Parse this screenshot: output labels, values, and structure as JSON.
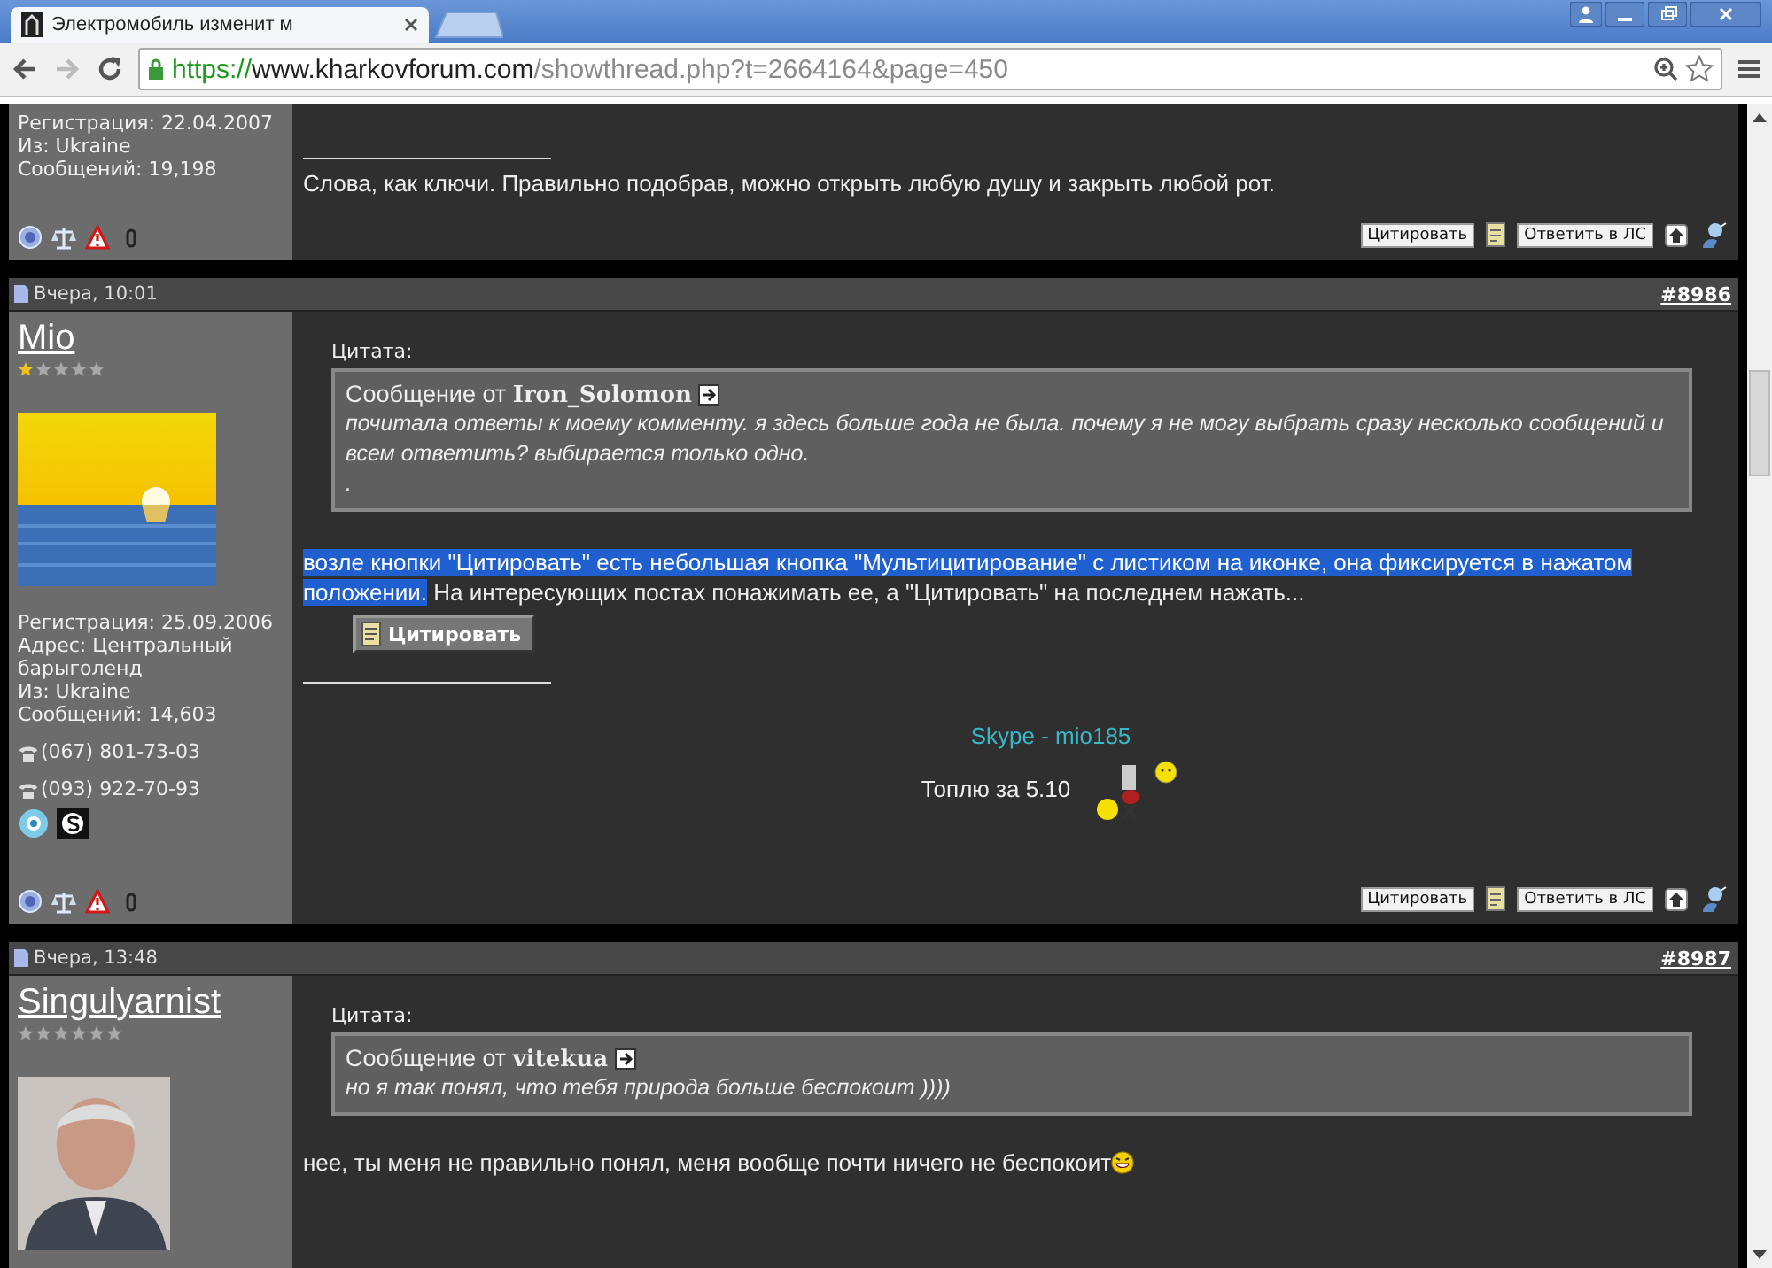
{
  "browser": {
    "tab_title": "Электромобиль изменит м",
    "url": {
      "scheme": "https://",
      "host": "www.kharkovforum.com",
      "path": "/showthread.php?t=2664164&page=450"
    }
  },
  "posts": [
    {
      "kind": "partial",
      "user": {
        "stats": [
          "Регистрация: 22.04.2007",
          "Из: Ukraine",
          "Сообщений: 19,198"
        ]
      },
      "signature": [
        {
          "kind": "plain",
          "text": "Слова, как ключи. Правильно подобрав, можно открыть любую душу и закрыть любой рот."
        }
      ],
      "actions": {
        "quote": "Цитировать",
        "reply_pm": "Ответить в ЛС"
      }
    },
    {
      "kind": "full",
      "date": "Вчера, 10:01",
      "number": "#8986",
      "user": {
        "name": "Mio",
        "rank": [
          {
            "filled": true
          },
          {
            "filled": false
          },
          {
            "filled": false
          },
          {
            "filled": false
          },
          {
            "filled": false
          }
        ],
        "avatar": {
          "kind": "picture"
        },
        "stats": [
          "Регистрация: 25.09.2006",
          "Адрес: Центральный барыголенд",
          "Из: Ukraine",
          "Сообщений: 14,603"
        ],
        "phones": [
          "(067) 801-73-03",
          "(093) 922-70-93"
        ],
        "contacts": true
      },
      "quote": {
        "label": "Цитата:",
        "from": "Сообщение от",
        "author": "Iron_Solomon",
        "lines": [
          "почитала ответы к моему комменту. я здесь больше года не была. почему я не могу выбрать сразу несколько сообщений и всем ответить? выбирается только одно.",
          "."
        ]
      },
      "message": [
        {
          "text": "возле кнопки \"Цитировать\" есть небольшая кнопка \"Мультицитирование\" с листиком на иконке, она фиксируется в нажатом положении.",
          "selected": true
        },
        {
          "text": " На интересующих постах понажимать ее, а \"Цитировать\" на последнем нажать...",
          "selected": false
        }
      ],
      "inline_button": "Цитировать",
      "signature": [
        {
          "kind": "link",
          "text": "Skype - mio185"
        },
        {
          "kind": "smileys",
          "text": "Топлю за 5.10"
        }
      ],
      "actions": {
        "quote": "Цитировать",
        "reply_pm": "Ответить в ЛС"
      }
    },
    {
      "kind": "full",
      "date": "Вчера, 13:48",
      "number": "#8987",
      "user": {
        "name": "Singulyarnist",
        "rank": [
          {
            "filled": false
          },
          {
            "filled": false
          },
          {
            "filled": false
          },
          {
            "filled": false
          },
          {
            "filled": false
          },
          {
            "filled": false
          }
        ],
        "avatar": {
          "kind": "picture"
        }
      },
      "quote": {
        "label": "Цитата:",
        "from": "Сообщение от",
        "author": "vitekua",
        "lines": [
          "но я так понял, что тебя природа больше беспокоит ))))"
        ]
      },
      "message": [
        {
          "text": "нее, ты меня не правильно понял, меня вообще почти ничего не беспокоит",
          "selected": false
        }
      ],
      "message_smiley": true
    }
  ]
}
